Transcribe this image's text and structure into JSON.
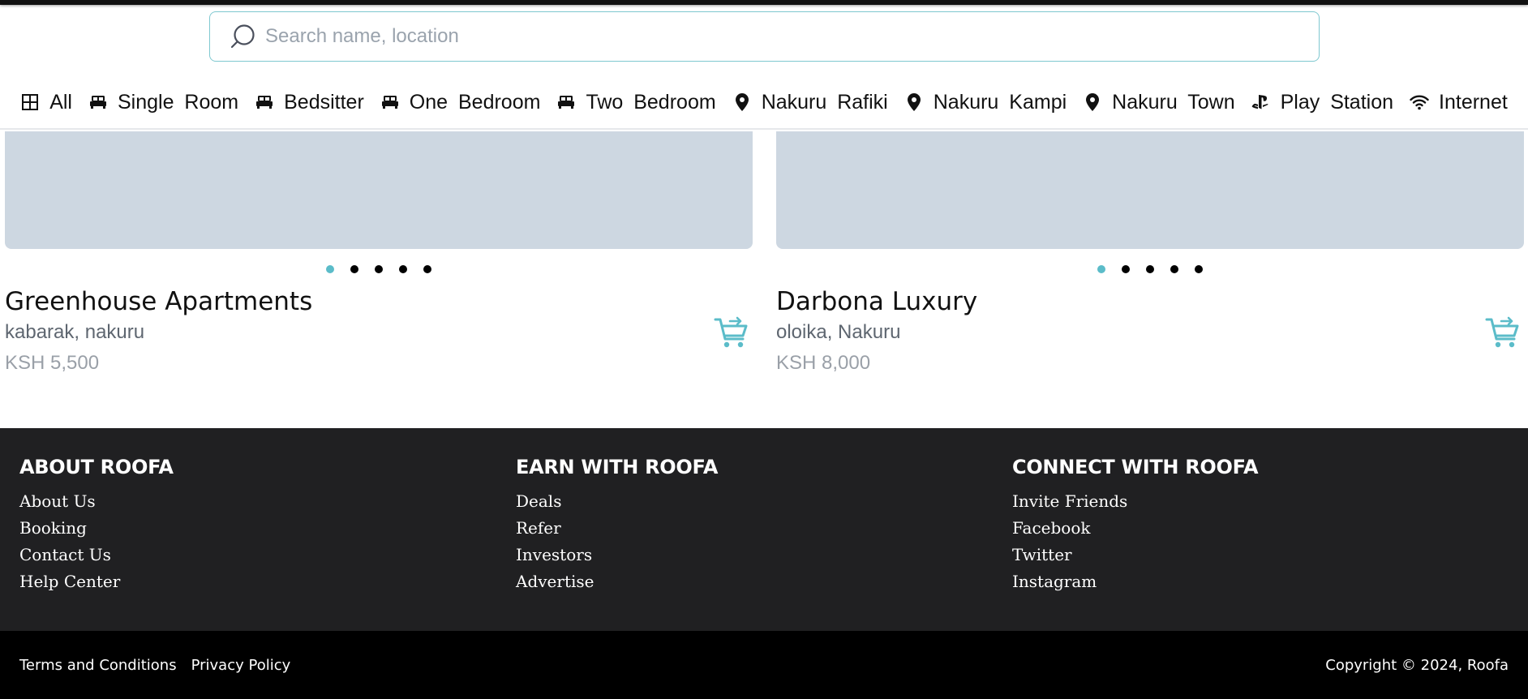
{
  "search": {
    "placeholder": "Search name, location"
  },
  "categories": [
    {
      "label": "All",
      "icon": "grid-icon"
    },
    {
      "label": "Single Room",
      "icon": "bed-icon"
    },
    {
      "label": "Bedsitter",
      "icon": "bed-icon"
    },
    {
      "label": "One Bedroom",
      "icon": "bed-icon"
    },
    {
      "label": "Two Bedroom",
      "icon": "bed-icon"
    },
    {
      "label": "Nakuru Rafiki",
      "icon": "map-pin-icon"
    },
    {
      "label": "Nakuru Kampi",
      "icon": "map-pin-icon"
    },
    {
      "label": "Nakuru Town",
      "icon": "map-pin-icon"
    },
    {
      "label": "Play Station",
      "icon": "playstation-icon"
    },
    {
      "label": "Internet",
      "icon": "wifi-icon"
    }
  ],
  "listings": [
    {
      "title": "Greenhouse Apartments",
      "location": "kabarak, nakuru",
      "price": "KSH 5,500"
    },
    {
      "title": "Darbona Luxury",
      "location": "oloika, Nakuru",
      "price": "KSH 8,000"
    }
  ],
  "footer": {
    "about": {
      "heading": "ABOUT ROOFA",
      "links": [
        "About Us",
        "Booking",
        "Contact Us",
        "Help Center"
      ]
    },
    "earn": {
      "heading": "EARN WITH ROOFA",
      "links": [
        "Deals",
        "Refer",
        "Investors",
        "Advertise"
      ]
    },
    "connect": {
      "heading": "CONNECT WITH ROOFA",
      "links": [
        "Invite Friends",
        "Facebook",
        "Twitter",
        "Instagram"
      ]
    }
  },
  "bottom": {
    "terms": "Terms and Conditions",
    "privacy": "Privacy Policy",
    "copyright": "Copyright © 2024, Roofa"
  },
  "colors": {
    "accent": "#5bbcc9",
    "image_placeholder": "#cdd7e1",
    "footer_bg": "#202022"
  }
}
